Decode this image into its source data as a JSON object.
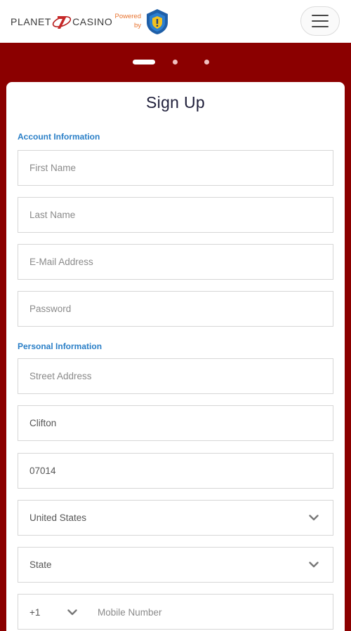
{
  "header": {
    "logo_left": "PLANET",
    "logo_right": "CASINO",
    "powered_line1": "Powered",
    "powered_line2": "by"
  },
  "carousel": {
    "slide_count": 3,
    "active_index": 0
  },
  "form": {
    "title": "Sign Up",
    "account_section": "Account Information",
    "personal_section": "Personal Information",
    "first_name_placeholder": "First Name",
    "last_name_placeholder": "Last Name",
    "email_placeholder": "E-Mail Address",
    "password_placeholder": "Password",
    "street_placeholder": "Street Address",
    "city_value": "Clifton",
    "zip_value": "07014",
    "country_value": "United States",
    "state_value": "State",
    "phone_code": "+1",
    "mobile_placeholder": "Mobile Number"
  },
  "colors": {
    "brand_red": "#8b0000",
    "section_blue": "#2a7fc7",
    "powered_orange": "#e8732e",
    "shield_blue": "#1f5fa8",
    "shield_gold": "#f3c21f"
  },
  "icons": [
    "seven-logo-icon",
    "shield-icon",
    "hamburger-menu-icon",
    "chevron-down-icon"
  ]
}
